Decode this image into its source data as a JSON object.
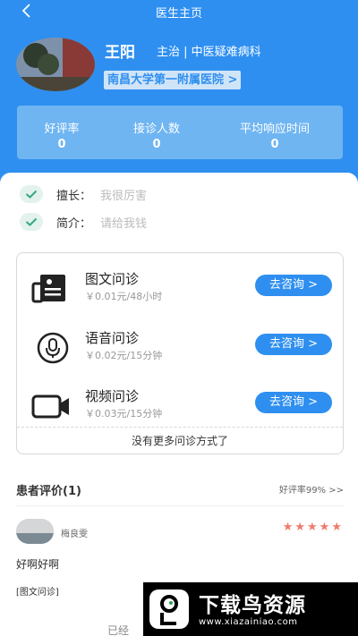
{
  "header": {
    "title": "医生主页",
    "doctor_name": "王阳",
    "doctor_title": "主治 | 中医疑难病科",
    "hospital": "南昌大学第一附属医院 >",
    "stats": [
      {
        "label": "好评率",
        "value": "0"
      },
      {
        "label": "接诊人数",
        "value": "0"
      },
      {
        "label": "平均响应时间",
        "value": "0"
      }
    ]
  },
  "info": {
    "specialty_label": "擅长：",
    "specialty_value": "我很厉害",
    "intro_label": "简介：",
    "intro_value": "请给我钱"
  },
  "consult": {
    "items": [
      {
        "name": "图文问诊",
        "price": "￥0.01元/48小时",
        "button": "去咨询 >",
        "icon": "image-text-icon"
      },
      {
        "name": "语音问诊",
        "price": "￥0.02元/15分钟",
        "button": "去咨询 >",
        "icon": "microphone-icon"
      },
      {
        "name": "视频问诊",
        "price": "￥0.03元/15分钟",
        "button": "去咨询 >",
        "icon": "video-camera-icon"
      }
    ],
    "no_more": "没有更多问诊方式了"
  },
  "reviews": {
    "heading": "患者评价(1)",
    "rate_link": "好评率99% >>",
    "items": [
      {
        "user": "梅良雯",
        "stars": "★★★★★",
        "text": "好啊好啊",
        "tag": "[图文问诊]"
      }
    ],
    "footer": "已经"
  },
  "banner": {
    "title": "下载鸟资源",
    "url": "www.xiazainiao.com"
  },
  "colors": {
    "primary": "#2e8ff0",
    "stats_bg": "#6fb5f2",
    "star": "#f07a6b",
    "check_bg": "#e3f2ee",
    "check": "#36a87a"
  }
}
